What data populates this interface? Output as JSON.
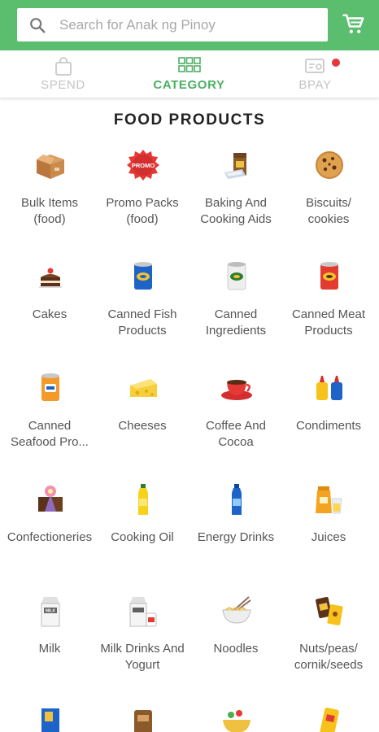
{
  "search": {
    "placeholder": "Search for Anak ng Pinoy"
  },
  "tabs": [
    {
      "label": "SPEND",
      "icon": "shopping-bag-icon",
      "active": false
    },
    {
      "label": "CATEGORY",
      "icon": "category-grid-icon",
      "active": true
    },
    {
      "label": "BPAY",
      "icon": "bill-pay-icon",
      "active": false
    }
  ],
  "section_title": "FOOD PRODUCTS",
  "colors": {
    "brand_green": "#5bbd6e",
    "active_tab": "#4caf63",
    "notification_dot": "#e8373c"
  },
  "categories": [
    {
      "label": "Bulk Items (food)",
      "icon": "box-icon"
    },
    {
      "label": "Promo Packs (food)",
      "icon": "promo-badge-icon"
    },
    {
      "label": "Baking And Cooking Aids",
      "icon": "baking-aids-icon"
    },
    {
      "label": "Biscuits/ cookies",
      "icon": "cookie-icon"
    },
    {
      "label": "Cakes",
      "icon": "cake-icon"
    },
    {
      "label": "Canned Fish Products",
      "icon": "canned-fish-icon"
    },
    {
      "label": "Canned Ingredients",
      "icon": "canned-ingredients-icon"
    },
    {
      "label": "Canned Meat Products",
      "icon": "canned-meat-icon"
    },
    {
      "label": "Canned Seafood Pro...",
      "icon": "canned-seafood-icon"
    },
    {
      "label": "Cheeses",
      "icon": "cheese-icon"
    },
    {
      "label": "Coffee And Cocoa",
      "icon": "coffee-cup-icon"
    },
    {
      "label": "Condiments",
      "icon": "condiments-icon"
    },
    {
      "label": "Confectioneries",
      "icon": "confectionery-icon"
    },
    {
      "label": "Cooking Oil",
      "icon": "oil-bottle-icon"
    },
    {
      "label": "Energy Drinks",
      "icon": "energy-drink-icon"
    },
    {
      "label": "Juices",
      "icon": "juice-icon"
    },
    {
      "label": "Milk",
      "icon": "milk-carton-icon"
    },
    {
      "label": "Milk Drinks And Yogurt",
      "icon": "milk-drinks-icon"
    },
    {
      "label": "Noodles",
      "icon": "noodles-icon"
    },
    {
      "label": "Nuts/peas/ cornik/seeds",
      "icon": "nuts-icon"
    }
  ]
}
